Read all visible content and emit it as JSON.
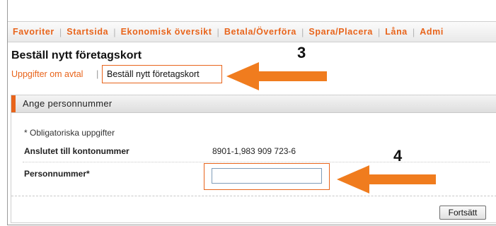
{
  "nav": {
    "items": [
      "Favoriter",
      "Startsida",
      "Ekonomisk översikt",
      "Betala/Överföra",
      "Spara/Placera",
      "Låna",
      "Admi"
    ],
    "separator": "|"
  },
  "page": {
    "title": "Beställ nytt företagskort",
    "breadcrumb_link": "Uppgifter om avtal",
    "breadcrumb_separator": "|",
    "breadcrumb_current": "Beställ nytt företagskort"
  },
  "annotations": {
    "step3": "3",
    "step4": "4",
    "arrow_color": "#f07c1e"
  },
  "panel": {
    "title": "Ange personnummer",
    "required_note": "* Obligatoriska uppgifter",
    "account_label": "Anslutet till kontonummer",
    "account_value": "8901-1,983 909 723-6",
    "pnr_label": "Personnummer*",
    "pnr_value": "",
    "submit_label": "Fortsätt"
  },
  "colors": {
    "accent": "#e8641b"
  }
}
